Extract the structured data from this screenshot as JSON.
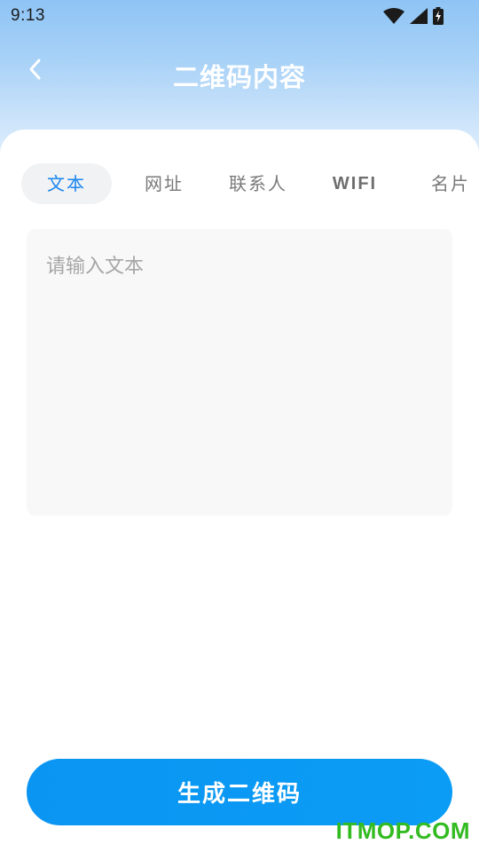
{
  "status_bar": {
    "time": "9:13",
    "icons": [
      "wifi-icon",
      "signal-icon",
      "battery-charging-icon"
    ]
  },
  "header": {
    "back_icon": "chevron-left-icon",
    "title": "二维码内容"
  },
  "tabs": [
    {
      "label": "文本",
      "active": true
    },
    {
      "label": "网址",
      "active": false
    },
    {
      "label": "联系人",
      "active": false
    },
    {
      "label": "WIFI",
      "active": false
    },
    {
      "label": "名片",
      "active": false
    }
  ],
  "input": {
    "value": "",
    "placeholder": "请输入文本"
  },
  "generate_button": {
    "label": "生成二维码"
  },
  "watermark": "ITMOP.COM",
  "colors": {
    "accent": "#1a86f0",
    "button": "#0a95f2",
    "header_gradient_top": "#8ec4f5",
    "watermark": "#33bb22"
  }
}
